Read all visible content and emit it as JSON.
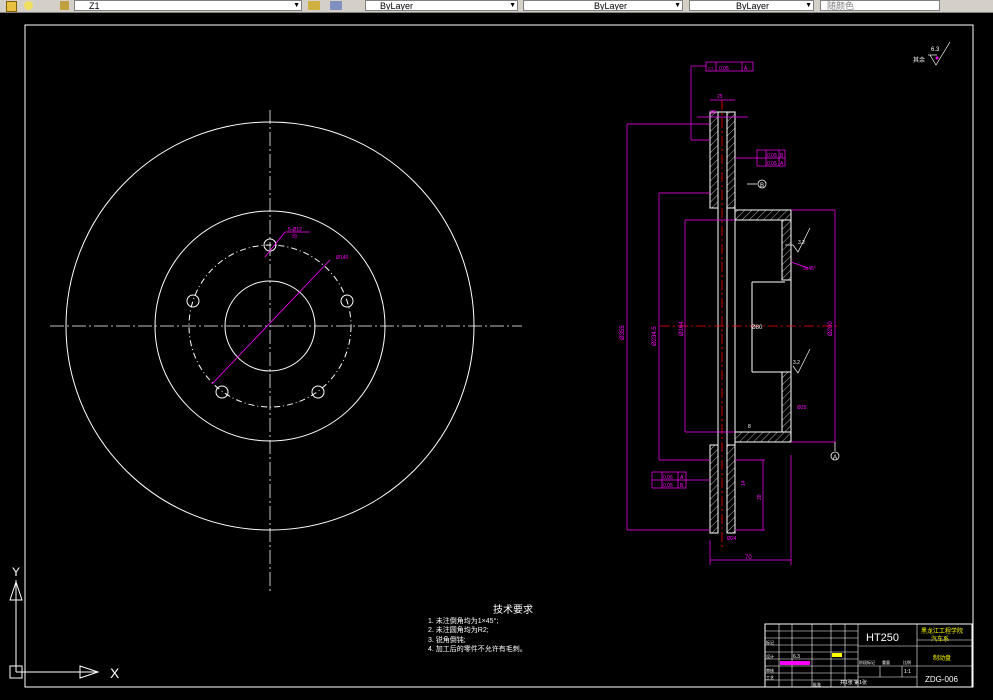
{
  "toolbar": {
    "layer_name": "Z1",
    "color_control": "ByLayer",
    "linetype_control": "ByLayer",
    "lineweight_control": "ByLayer",
    "plotstyle_control": "随颜色"
  },
  "drawing": {
    "front_view": {
      "hole_callout_line1": "5-Ø12",
      "hole_callout_line2": "均",
      "bolt_circle_label": "Ø140"
    },
    "section_view": {
      "flatness_symbol": "▭",
      "flatness_value": "0.05",
      "flatness_datum": "A",
      "top_dim_1": "25",
      "top_dim_2": "Ø5",
      "tolerance_a_value": "0.05",
      "tolerance_a_datum": "B",
      "tolerance_b_value": "0.05",
      "tolerance_b_datum": "A",
      "datum_b_label": "B",
      "datum_a_label": "A",
      "dim_overall_dia": "Ø355",
      "dim_hub_outer": "Ø234.5",
      "dim_hub_inner": "Ø164",
      "dim_center_bore": "Ø80",
      "dim_right_dia": "Ø200",
      "roughness_upper": "3.2",
      "roughness_lower": "3.2",
      "chamfer_label": "3x45°",
      "dim_inner_depth": "Ø25",
      "dim_hub_thick": "8",
      "tolerance_c_value": "0.06",
      "tolerance_c_datum": "A",
      "tolerance_d_value": "0.05",
      "tolerance_d_datum": "B",
      "dim_slot": "14",
      "dim_width_r": "28",
      "dim_bottom_small": "Ø24",
      "dim_overall_width": "70",
      "corner_roughness_value": "6.3",
      "corner_roughness_text": "其余"
    },
    "technical_requirements": {
      "title": "技术要求",
      "items": [
        "1. 未注倒角均为1×45°;",
        "2. 未注圆角均为R2;",
        "3. 锐角倒钝;",
        "4. 加工后的零件不允许有毛刺。"
      ]
    },
    "title_block": {
      "material": "HT250",
      "school": "黑龙江工程学院",
      "department": "汽车系",
      "part_name": "制动盘",
      "drawing_number": "ZDG-006",
      "scale": "1:1",
      "sheet_info": "共1张 第1张",
      "roughness_mark": "6.3",
      "label_mark": "标记",
      "label_design": "设计",
      "label_review": "审核",
      "label_process": "工艺",
      "label_approve": "批准",
      "label_stage": "阶段标记",
      "label_weight": "重量",
      "label_scale": "比例"
    },
    "ucs": {
      "x_label": "X",
      "y_label": "Y"
    }
  },
  "colors": {
    "background": "#000000",
    "lines": "#ffffff",
    "dimensions": "#ff00ff",
    "centerlines": "#ff0000",
    "toolbar": "#d4d0c8"
  }
}
